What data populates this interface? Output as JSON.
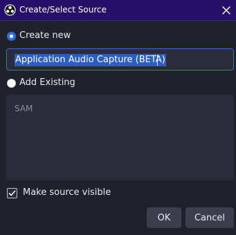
{
  "window": {
    "title": "Create/Select Source",
    "icon": "obs-logo-icon",
    "close_icon": "close-icon",
    "titlebar_color": "#250f69"
  },
  "options": {
    "create_new": {
      "label": "Create new",
      "selected": true
    },
    "add_existing": {
      "label": "Add Existing",
      "selected": false
    }
  },
  "name_input": {
    "value": "Application Audio Capture (BETA)",
    "text_selected": true
  },
  "existing_sources": {
    "items": [
      "SAM"
    ]
  },
  "visible_checkbox": {
    "label": "Make source visible",
    "checked": true
  },
  "buttons": {
    "ok": "OK",
    "cancel": "Cancel"
  },
  "colors": {
    "accent": "#2f6fe0",
    "background": "#1f212b",
    "field": "#2a2d39"
  }
}
